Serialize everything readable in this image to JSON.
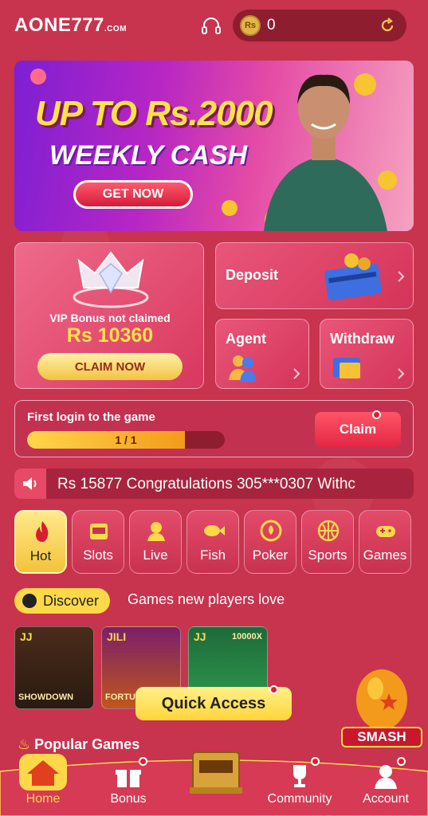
{
  "header": {
    "logo": "AONE777",
    "logo_domain": ".COM",
    "balance": "0",
    "coin_symbol": "Rs"
  },
  "banner": {
    "line1": "UP TO Rs.2000",
    "line2": "WEEKLY CASH",
    "button": "GET NOW"
  },
  "vip": {
    "label": "VIP Bonus not claimed",
    "amount": "Rs 10360",
    "button": "CLAIM NOW"
  },
  "cards": {
    "deposit": "Deposit",
    "agent": "Agent",
    "withdraw": "Withdraw"
  },
  "first_login": {
    "title": "First login to the game",
    "progress_text": "1 / 1",
    "progress_fraction": 0.8,
    "button": "Claim"
  },
  "marquee": {
    "text": "Rs 15877    Congratulations 305***0307 Withc"
  },
  "categories": [
    {
      "label": "Hot",
      "icon": "flame-icon",
      "active": true
    },
    {
      "label": "Slots",
      "icon": "slot-machine-icon"
    },
    {
      "label": "Live",
      "icon": "live-dealer-icon"
    },
    {
      "label": "Fish",
      "icon": "fish-icon"
    },
    {
      "label": "Poker",
      "icon": "poker-chip-icon"
    },
    {
      "label": "Sports",
      "icon": "basketball-icon"
    },
    {
      "label": "Games",
      "icon": "gamepad-icon"
    }
  ],
  "discover": {
    "label": "Discover",
    "subtitle": "Games new players love"
  },
  "games": [
    {
      "tag": "JJ",
      "name": "SHOWDOWN"
    },
    {
      "tag": "JILI",
      "name": "FORTUNE"
    },
    {
      "tag": "JJ",
      "name": "10000X"
    }
  ],
  "quick_access": "Quick Access",
  "smash": "SMASH",
  "popular": "Popular Games",
  "nav": {
    "home": "Home",
    "bonus": "Bonus",
    "community": "Community",
    "account": "Account"
  },
  "colors": {
    "background": "#c8334d",
    "accent_yellow": "#ffd84a",
    "dark_red": "#8e1d30"
  }
}
